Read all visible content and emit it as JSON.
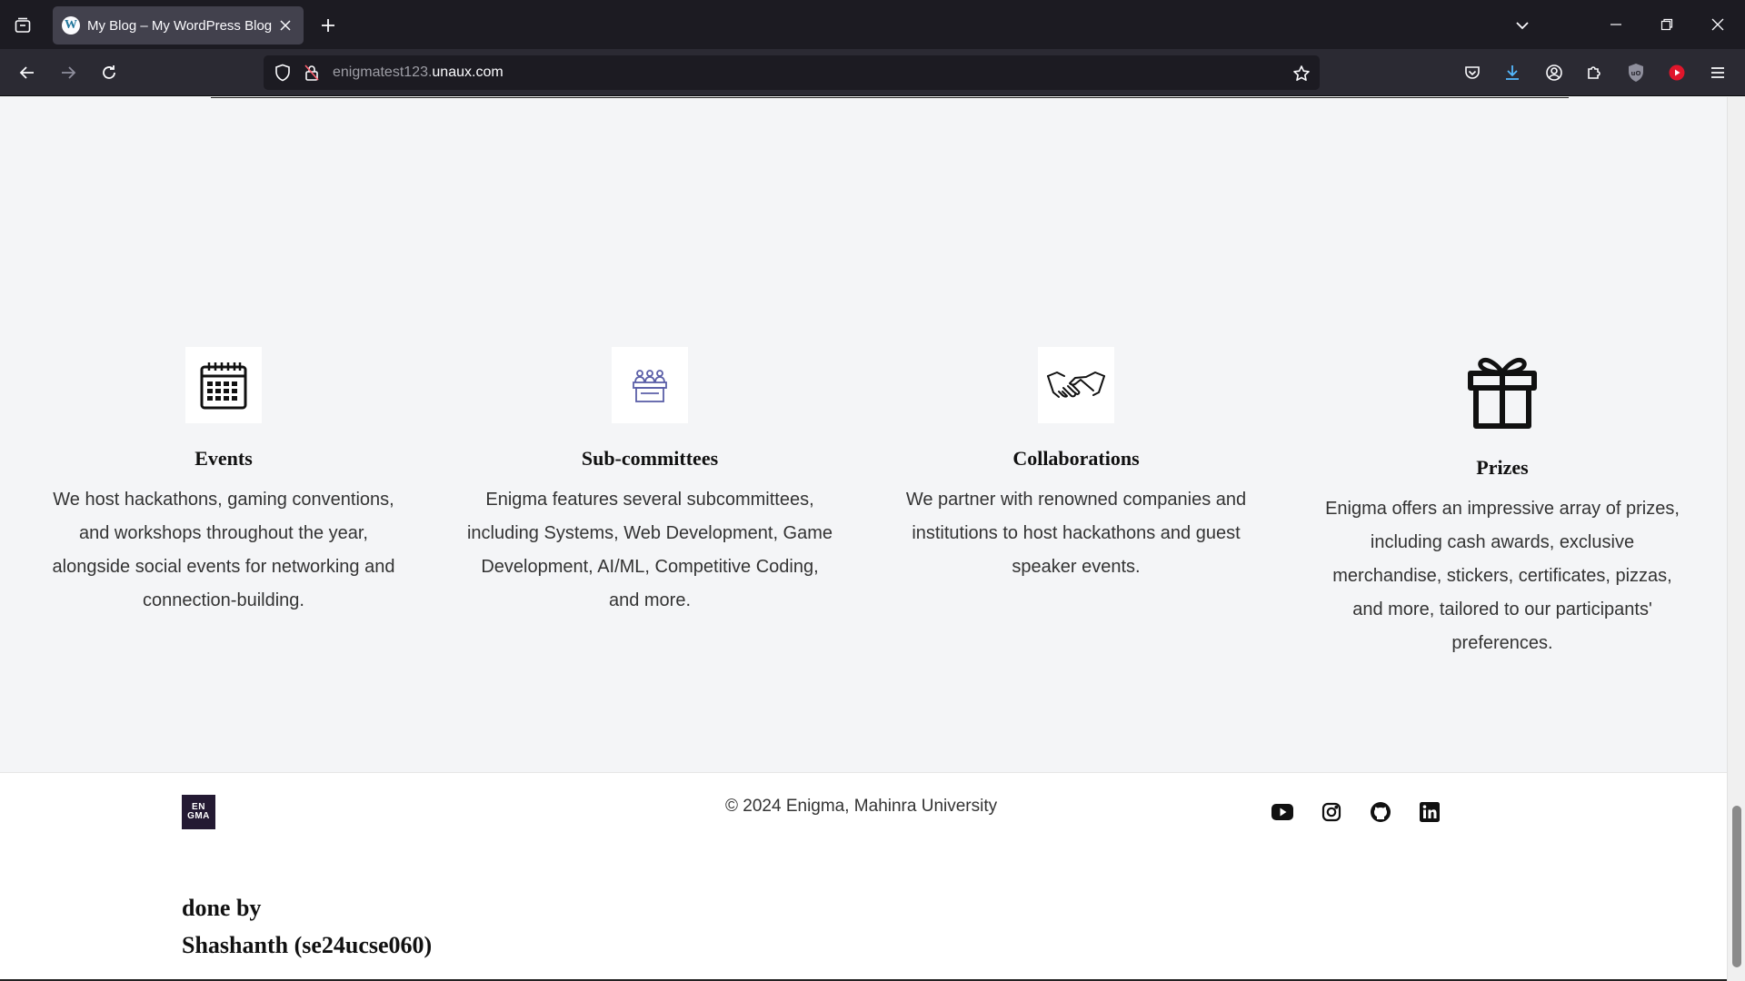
{
  "browser": {
    "tab_title": "My Blog – My WordPress Blog",
    "favicon_letter": "W",
    "url_prefix": "enigmatest123.",
    "url_host": "unaux.com"
  },
  "features": [
    {
      "title": "Events",
      "icon": "calendar-icon",
      "text": "We host hackathons, gaming conventions, and workshops throughout the year, alongside social events for networking and connection-building."
    },
    {
      "title": "Sub-committees",
      "icon": "committee-icon",
      "text": "Enigma features several subcommittees, including Systems, Web Development, Game Development, AI/ML, Competitive Coding, and more."
    },
    {
      "title": "Collaborations",
      "icon": "handshake-icon",
      "text": "We partner with renowned companies and institutions to host hackathons and guest speaker events."
    },
    {
      "title": "Prizes",
      "icon": "gift-icon",
      "text": "Enigma offers an impressive array of prizes, including cash awards, exclusive merchandise, stickers, certificates, pizzas, and more, tailored to our participants' preferences."
    }
  ],
  "footer": {
    "logo_line1": "EN",
    "logo_line2": "GMA",
    "copyright": "© 2024 Enigma, Mahinra University",
    "social": [
      "youtube-icon",
      "instagram-icon",
      "github-icon",
      "linkedin-icon"
    ],
    "credit_line1": "done by",
    "credit_line2": "Shashanth (se24ucse060)"
  }
}
